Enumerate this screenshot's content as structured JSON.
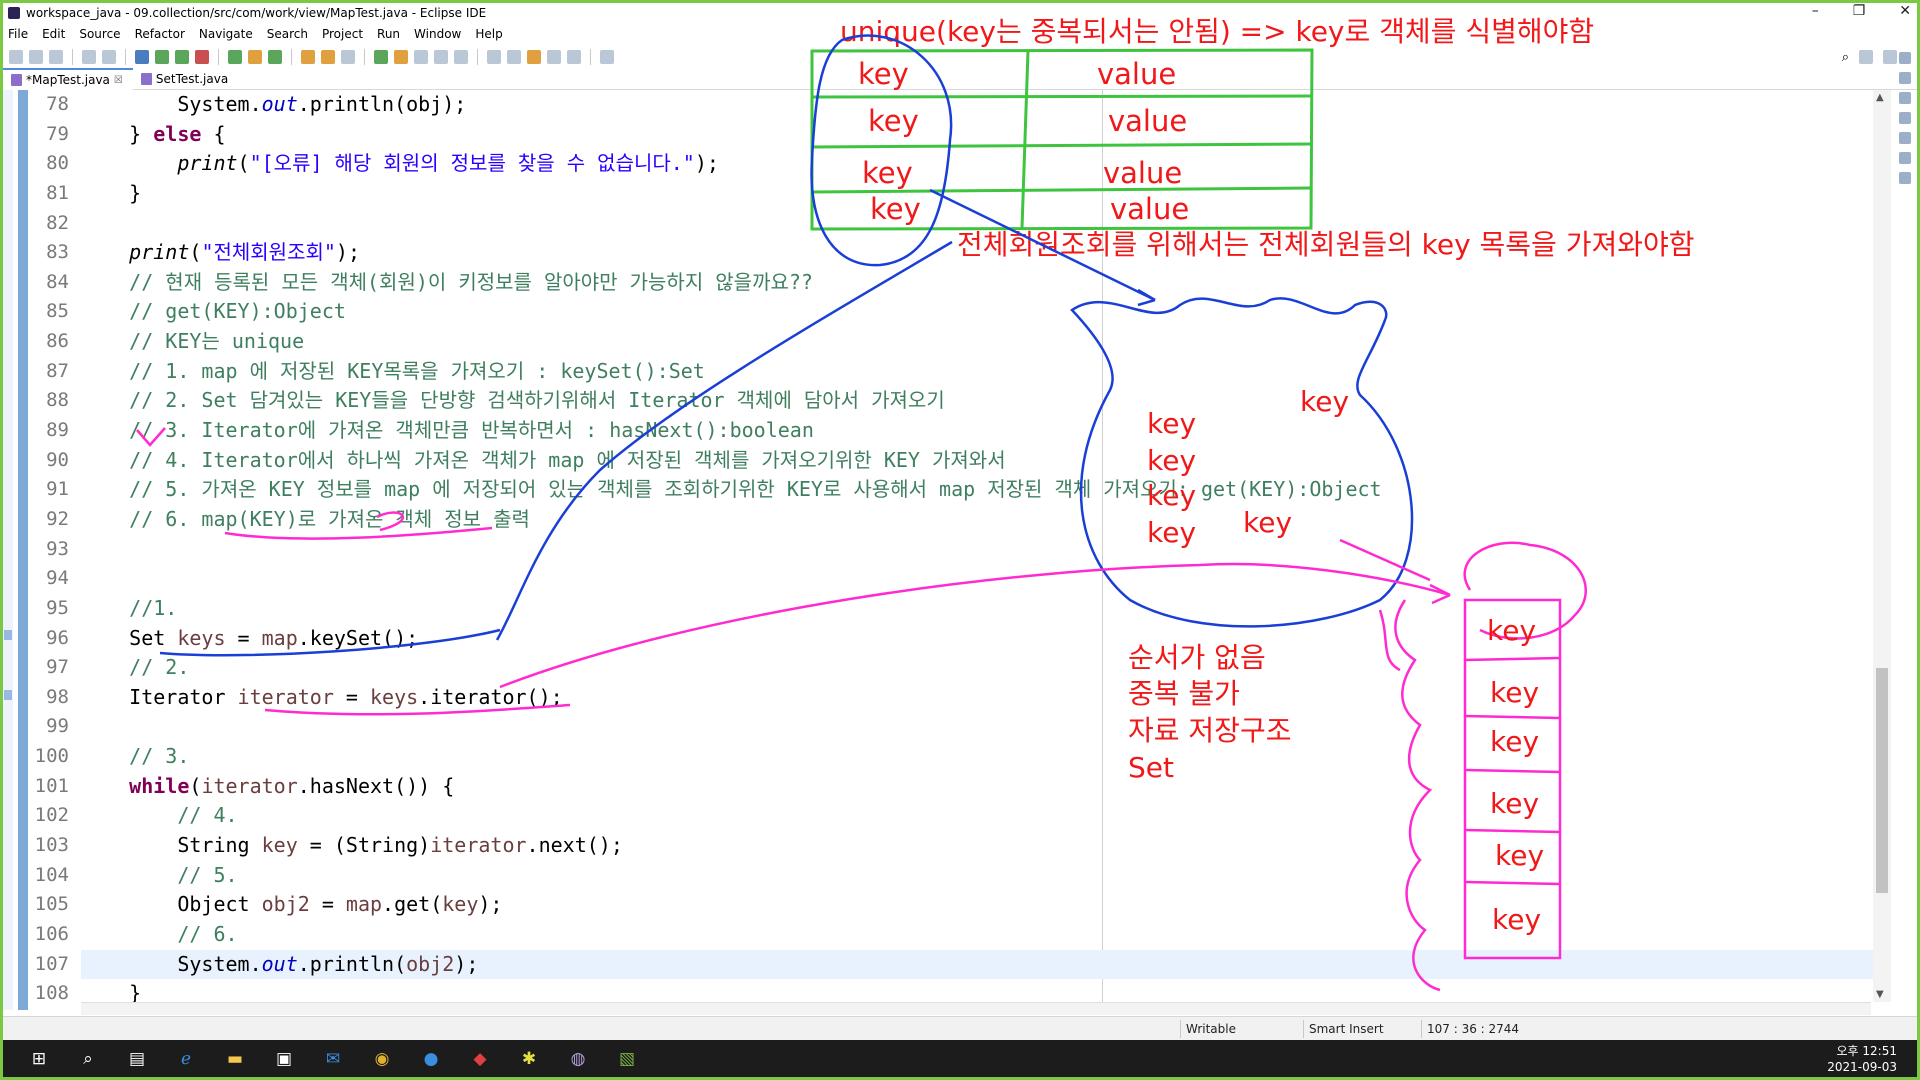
{
  "window": {
    "title": "workspace_java - 09.collection/src/com/work/view/MapTest.java - Eclipse IDE"
  },
  "menu": [
    "File",
    "Edit",
    "Source",
    "Refactor",
    "Navigate",
    "Search",
    "Project",
    "Run",
    "Window",
    "Help"
  ],
  "tabs": [
    {
      "label": "*MapTest.java",
      "close": "☒"
    },
    {
      "label": "SetTest.java",
      "close": ""
    }
  ],
  "editor": {
    "lines": [
      {
        "num": "78",
        "indent": "        ",
        "segments": [
          [
            "System.",
            ""
          ],
          [
            "out",
            "fld"
          ],
          [
            ".println(obj);",
            ""
          ]
        ]
      },
      {
        "num": "79",
        "indent": "    ",
        "segments": [
          [
            "} ",
            ""
          ],
          [
            "else",
            "kw"
          ],
          [
            " {",
            ""
          ]
        ]
      },
      {
        "num": "80",
        "indent": "        ",
        "segments": [
          [
            "print",
            "mth"
          ],
          [
            "(",
            ""
          ],
          [
            "\"[오류] 해당 회원의 정보를 찾을 수 없습니다.\"",
            "str"
          ],
          [
            ");",
            ""
          ]
        ]
      },
      {
        "num": "81",
        "indent": "    ",
        "segments": [
          [
            "}",
            ""
          ]
        ]
      },
      {
        "num": "82",
        "indent": "",
        "segments": []
      },
      {
        "num": "83",
        "indent": "    ",
        "segments": [
          [
            "print",
            "mth"
          ],
          [
            "(",
            ""
          ],
          [
            "\"전체회원조회\"",
            "str"
          ],
          [
            ");",
            ""
          ]
        ]
      },
      {
        "num": "84",
        "indent": "    ",
        "segments": [
          [
            "// 현재 등록된 모든 객체(회원)이 키정보를 알아야만 가능하지 않을까요??",
            "cmt"
          ]
        ]
      },
      {
        "num": "85",
        "indent": "    ",
        "segments": [
          [
            "// get(KEY):Object",
            "cmt"
          ]
        ]
      },
      {
        "num": "86",
        "indent": "    ",
        "segments": [
          [
            "// KEY는 unique",
            "cmt"
          ]
        ]
      },
      {
        "num": "87",
        "indent": "    ",
        "segments": [
          [
            "// 1. map 에 저장된 KEY목록을 가져오기 : keySet():Set",
            "cmt"
          ]
        ]
      },
      {
        "num": "88",
        "indent": "    ",
        "segments": [
          [
            "// 2. Set 담겨있는 KEY들을 단방향 검색하기위해서 Iterator 객체에 담아서 가져오기",
            "cmt"
          ]
        ]
      },
      {
        "num": "89",
        "indent": "    ",
        "segments": [
          [
            "// 3. Iterator에 가져온 객체만큼 반복하면서 : hasNext():boolean",
            "cmt"
          ]
        ]
      },
      {
        "num": "90",
        "indent": "    ",
        "segments": [
          [
            "// 4. Iterator에서 하나씩 가져온 객체가 map 에 저장된 객체를 가져오기위한 KEY 가져와서",
            "cmt"
          ]
        ]
      },
      {
        "num": "91",
        "indent": "    ",
        "segments": [
          [
            "// 5. 가져온 KEY 정보를 map 에 저장되어 있는 객체를 조회하기위한 KEY로 사용해서 map 저장된 객체 가져오기: get(KEY):Object",
            "cmt"
          ]
        ]
      },
      {
        "num": "92",
        "indent": "    ",
        "segments": [
          [
            "// 6. map(KEY)로 가져온 객체 정보 출력",
            "cmt"
          ]
        ]
      },
      {
        "num": "93",
        "indent": "",
        "segments": []
      },
      {
        "num": "94",
        "indent": "",
        "segments": []
      },
      {
        "num": "95",
        "indent": "    ",
        "segments": [
          [
            "//1.",
            "cmt"
          ]
        ]
      },
      {
        "num": "96",
        "indent": "    ",
        "segments": [
          [
            "Set ",
            ""
          ],
          [
            "keys",
            "var"
          ],
          [
            " = ",
            ""
          ],
          [
            "map",
            "var"
          ],
          [
            ".keySet();",
            ""
          ]
        ]
      },
      {
        "num": "97",
        "indent": "    ",
        "segments": [
          [
            "// 2.",
            "cmt"
          ]
        ]
      },
      {
        "num": "98",
        "indent": "    ",
        "segments": [
          [
            "Iterator ",
            ""
          ],
          [
            "iterator",
            "var"
          ],
          [
            " = ",
            ""
          ],
          [
            "keys",
            "var"
          ],
          [
            ".iterator();",
            ""
          ]
        ]
      },
      {
        "num": "99",
        "indent": "",
        "segments": []
      },
      {
        "num": "100",
        "indent": "    ",
        "segments": [
          [
            "// 3.",
            "cmt"
          ]
        ]
      },
      {
        "num": "101",
        "indent": "    ",
        "segments": [
          [
            "while",
            "kw"
          ],
          [
            "(",
            ""
          ],
          [
            "iterator",
            "var"
          ],
          [
            ".hasNext()) {",
            ""
          ]
        ]
      },
      {
        "num": "102",
        "indent": "        ",
        "segments": [
          [
            "// 4.",
            "cmt"
          ]
        ]
      },
      {
        "num": "103",
        "indent": "        ",
        "segments": [
          [
            "String ",
            ""
          ],
          [
            "key",
            "var"
          ],
          [
            " = (String)",
            ""
          ],
          [
            "iterator",
            "var"
          ],
          [
            ".next();",
            ""
          ]
        ]
      },
      {
        "num": "104",
        "indent": "        ",
        "segments": [
          [
            "// 5.",
            "cmt"
          ]
        ]
      },
      {
        "num": "105",
        "indent": "        ",
        "segments": [
          [
            "Object ",
            ""
          ],
          [
            "obj2",
            "var"
          ],
          [
            " = ",
            ""
          ],
          [
            "map",
            "var"
          ],
          [
            ".get(",
            ""
          ],
          [
            "key",
            "var"
          ],
          [
            ");",
            ""
          ]
        ]
      },
      {
        "num": "106",
        "indent": "        ",
        "segments": [
          [
            "// 6.",
            "cmt"
          ]
        ]
      },
      {
        "num": "107",
        "indent": "        ",
        "current": true,
        "segments": [
          [
            "System.",
            ""
          ],
          [
            "out",
            "fld"
          ],
          [
            ".println(",
            ""
          ],
          [
            "obj2",
            "var"
          ],
          [
            ");",
            ""
          ]
        ]
      },
      {
        "num": "108",
        "indent": "    ",
        "segments": [
          [
            "}",
            ""
          ]
        ]
      }
    ]
  },
  "annotations": {
    "top_note": "unique(key는 중복되서는 안됨) => key로 객체를 식별해야함",
    "table_rows": [
      {
        "key": "key",
        "value": "value"
      },
      {
        "key": "key",
        "value": "value"
      },
      {
        "key": "key",
        "value": "value"
      },
      {
        "key": "key",
        "value": "value"
      }
    ],
    "mid_note": "전체회원조회를 위해서는 전체회원들의 key 목록을 가져와야함",
    "bag_keys": [
      "key",
      "key",
      "key",
      "key",
      "key",
      "key"
    ],
    "set_note": [
      "순서가 없음",
      "중복 불가",
      "자료 저장구조",
      "Set"
    ],
    "list_keys": [
      "key",
      "key",
      "key",
      "key",
      "key",
      "key"
    ],
    "colors": {
      "red": "#f01818",
      "blue": "#1a3fd6",
      "green": "#3ec43e",
      "magenta": "#ff2bd0"
    }
  },
  "status": {
    "writable": "Writable",
    "insert": "Smart Insert",
    "position": "107 : 36 : 2744"
  },
  "clock": {
    "time": "오후 12:51",
    "date": "2021-09-03"
  },
  "taskbar_icons": [
    "windows-start-icon",
    "search-icon",
    "task-view-icon",
    "edge-icon",
    "file-explorer-icon",
    "store-icon",
    "mail-icon",
    "chrome-icon",
    "zoom-icon",
    "app-icon",
    "slack-icon",
    "eclipse-icon",
    "notepad-icon"
  ]
}
